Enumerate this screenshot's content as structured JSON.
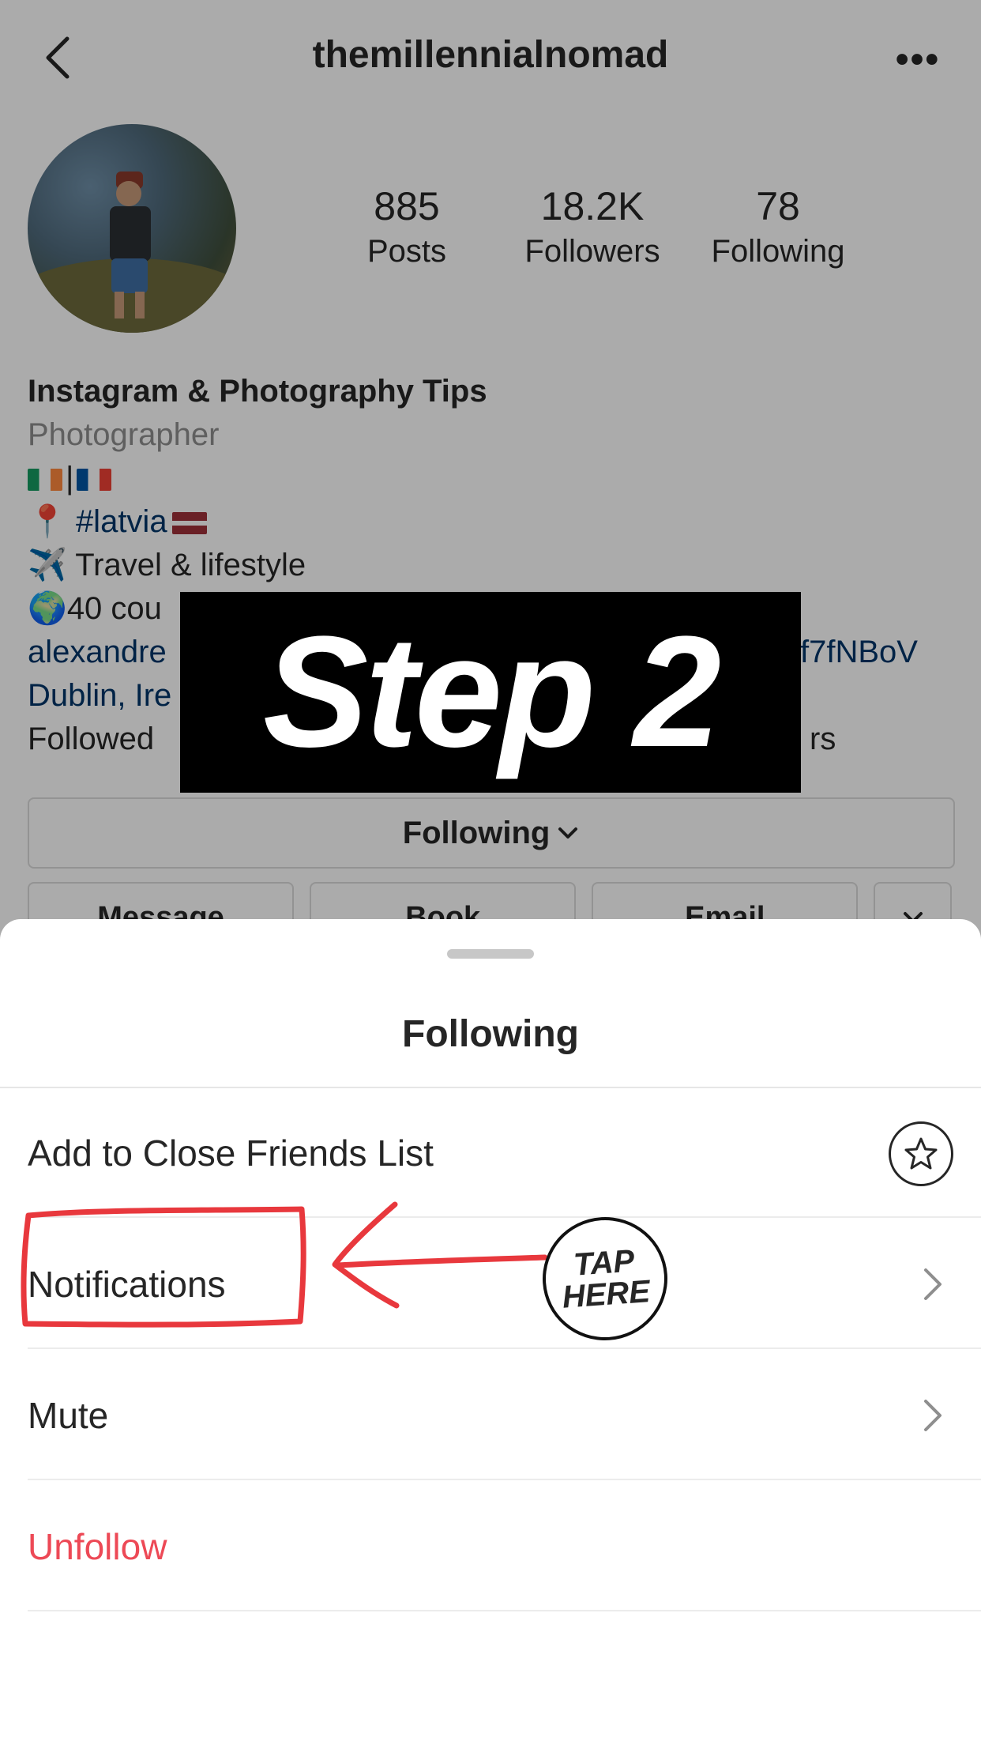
{
  "profile": {
    "username": "themillennialnomad",
    "more_label": "•••",
    "stats": [
      {
        "value": "885",
        "label": "Posts"
      },
      {
        "value": "18.2K",
        "label": "Followers"
      },
      {
        "value": "78",
        "label": "Following"
      }
    ],
    "bio": {
      "name": "Instagram & Photography Tips",
      "category": "Photographer",
      "flags_sep": "|",
      "location_tag": "#latvia",
      "line_travel": "✈️ Travel & lifestyle",
      "line_countries": "40 cou",
      "link_left": "alexandre",
      "link_right": "f7fNBoV",
      "city": "Dublin, Ire",
      "followed_left": "Followed",
      "followed_right": "rs"
    },
    "following_button": "Following",
    "action_buttons": [
      "Message",
      "Book",
      "Email"
    ]
  },
  "overlay": {
    "step_text": "Step 2",
    "tap_line1": "TAP",
    "tap_line2": "HERE"
  },
  "sheet": {
    "title": "Following",
    "options": [
      {
        "label": "Add to Close Friends List",
        "icon": "star-icon"
      },
      {
        "label": "Notifications",
        "icon": "chevron-right-icon"
      },
      {
        "label": "Mute",
        "icon": "chevron-right-icon"
      },
      {
        "label": "Unfollow",
        "color": "#ed4956"
      }
    ]
  }
}
